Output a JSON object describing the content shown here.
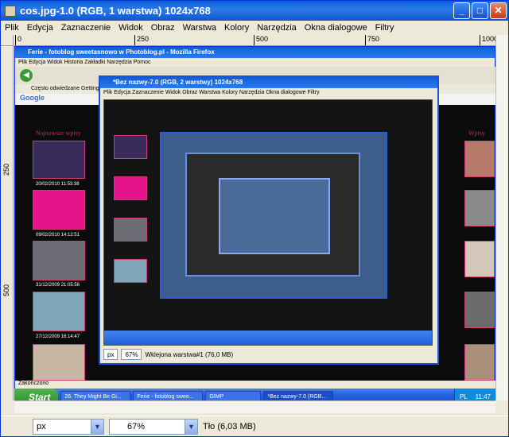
{
  "window": {
    "title": "cos.jpg-1.0 (RGB, 1 warstwa) 1024x768",
    "buttons": {
      "minimize": "_",
      "maximize": "□",
      "close": "✕"
    }
  },
  "menu": [
    "Plik",
    "Edycja",
    "Zaznaczenie",
    "Widok",
    "Obraz",
    "Warstwa",
    "Kolory",
    "Narzędzia",
    "Okna dialogowe",
    "Filtry"
  ],
  "ruler": {
    "top": [
      "0",
      "250",
      "500",
      "750",
      "1000"
    ],
    "left": [
      "250",
      "500"
    ]
  },
  "canvas": {
    "firefox_title": "Ferie - fotoblog sweetasnowo w Photoblog.pl - Mozilla Firefox",
    "firefox_menu": "Plik   Edycja   Widok   Historia   Zakładki   Narzędzia   Pomoc",
    "firefox_status": "Zakończono",
    "gimp2_title": "*Bez nazwy-7.0 (RGB, 2 warstwy) 1024x768",
    "gimp2_menu": "Plik  Edycja  Zaznaczenie  Widok  Obraz  Warstwa  Kolory  Narzędzia  Okna dialogowe  Filtry",
    "gimp2_status": "Wklejona warstwa#1 (76,0 MB)",
    "gimp2_zoom": "67%",
    "gimp2_unit": "px",
    "side_heading": "Najnowsze wpisy",
    "right_heading": "Wpisy",
    "dates": [
      "20/02/2010 11:53:38",
      "09/02/2010 14:12:51",
      "31/12/2009 21:05:56",
      "27/12/2009 16:14:47"
    ],
    "google_label": "Google",
    "bookmarks": "Często odwiedzane   Getting"
  },
  "taskbar": {
    "start": "Start",
    "tasks": [
      "26. They Might Be Gi...",
      "Ferie - fotoblog swee...",
      "GIMP",
      "*Bez nazwy-7.0 (RGB..."
    ],
    "clock": "11:47",
    "lang": "PL"
  },
  "statusbar": {
    "unit": "px",
    "zoom": "67%",
    "info": "Tło (6,03 MB)"
  },
  "colors": {
    "accent": "#0a5fd8",
    "pink": "#e0196b",
    "xp_green": "#2f8c2f"
  }
}
